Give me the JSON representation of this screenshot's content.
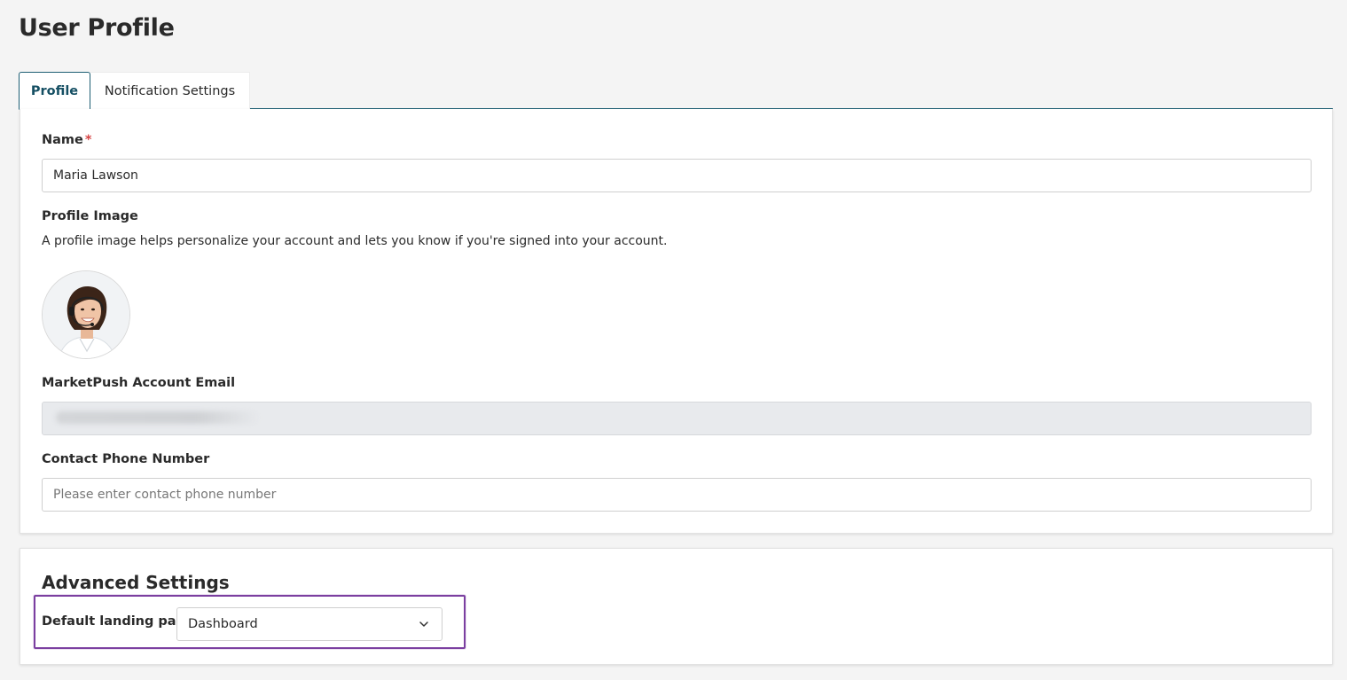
{
  "page": {
    "title": "User Profile"
  },
  "tabs": [
    {
      "label": "Profile",
      "active": true
    },
    {
      "label": "Notification Settings",
      "active": false
    }
  ],
  "profile": {
    "name_label": "Name",
    "required_mark": "*",
    "name_value": "Maria Lawson",
    "image_label": "Profile Image",
    "image_help": "A profile image helps personalize your account and lets you know if you're signed into your account.",
    "avatar_icon": "avatar-photo",
    "email_label": "MarketPush Account Email",
    "email_value": "",
    "phone_label": "Contact Phone Number",
    "phone_value": "",
    "phone_placeholder": "Please enter contact phone number"
  },
  "advanced": {
    "title": "Advanced Settings",
    "landing_label": "Default landing page",
    "landing_value": "Dashboard",
    "dropdown_icon": "chevron-down-icon",
    "highlight_color": "#7b3fa0"
  },
  "colors": {
    "accent": "#1e5f74",
    "required": "#d64545"
  }
}
